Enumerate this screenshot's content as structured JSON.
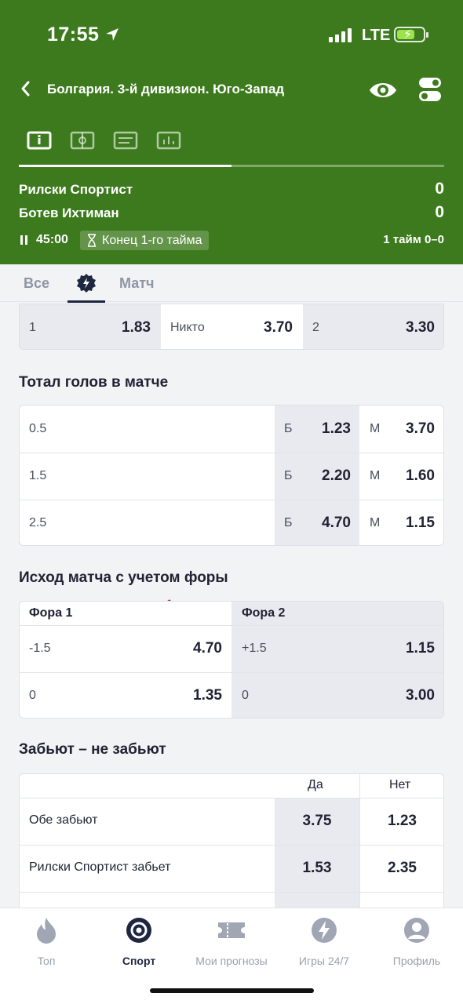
{
  "status": {
    "time": "17:55",
    "network": "LTE"
  },
  "header": {
    "league": "Болгария. 3-й дивизион. Юго-Запад",
    "match_progress": 0.5,
    "team1": {
      "name": "Рилски Спортист",
      "score": "0"
    },
    "team2": {
      "name": "Ботев Ихтиман",
      "score": "0"
    },
    "clock": "45:00",
    "period": "Конец 1-го тайма",
    "half_score": "1 тайм 0–0",
    "icons": [
      "info-icon",
      "field-icon",
      "lineup-icon",
      "stats-icon"
    ]
  },
  "filter_tabs": {
    "all": "Все",
    "match": "Матч"
  },
  "result": {
    "cells": [
      {
        "label": "1",
        "odd": "1.83"
      },
      {
        "label": "Никто",
        "odd": "3.70"
      },
      {
        "label": "2",
        "odd": "3.30"
      }
    ]
  },
  "totals": {
    "title": "Тотал голов в матче",
    "over_label": "Б",
    "under_label": "М",
    "rows": [
      {
        "line": "0.5",
        "over": "1.23",
        "under": "3.70"
      },
      {
        "line": "1.5",
        "over": "2.20",
        "under": "1.60"
      },
      {
        "line": "2.5",
        "over": "4.70",
        "under": "1.15"
      }
    ]
  },
  "handicap": {
    "title": "Исход матча с учетом форы",
    "col1": "Фора 1",
    "col2": "Фора 2",
    "rows": [
      {
        "h1": "-1.5",
        "o1": "4.70",
        "h2": "+1.5",
        "o2": "1.15"
      },
      {
        "h1": "0",
        "o1": "1.35",
        "h2": "0",
        "o2": "3.00"
      }
    ]
  },
  "btts": {
    "title": "Забьют – не забьют",
    "yes": "Да",
    "no": "Нет",
    "rows": [
      {
        "label": "Обе забьют",
        "yes": "3.75",
        "no": "1.23"
      },
      {
        "label": "Рилски Спортист забьет",
        "yes": "1.53",
        "no": "2.35"
      }
    ]
  },
  "bottom_nav": [
    {
      "label": "Топ",
      "icon": "flame-icon"
    },
    {
      "label": "Спорт",
      "icon": "sport-icon"
    },
    {
      "label": "Мои прогнозы",
      "icon": "ticket-icon"
    },
    {
      "label": "Игры 24/7",
      "icon": "lightning-icon"
    },
    {
      "label": "Профиль",
      "icon": "profile-icon"
    }
  ],
  "colors": {
    "header_green": "#3c7a1d",
    "accent_navy": "#1f2740",
    "annotation_red": "#d9261c"
  }
}
